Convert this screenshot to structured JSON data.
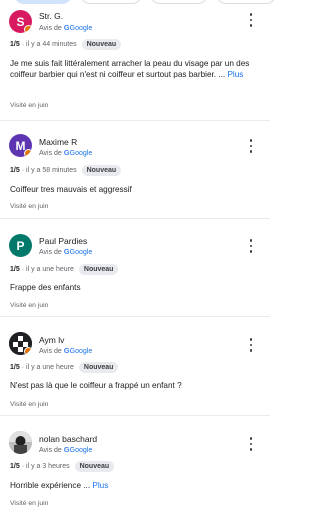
{
  "reviews": [
    {
      "name": "Str. G.",
      "avatar_letter": "S",
      "avatar_color": "#d81b60",
      "source_prefix": "Avis de",
      "source_name": "Google",
      "rating": "1/5",
      "time": "· il y a 44 minutes",
      "badge": "Nouveau",
      "text": "Je me suis fait littéralement arracher la peau du visage par un des coiffeur barbier qui n'est ni coiffeur et surtout pas barbier. ...",
      "more": "Plus",
      "visited": "Visité en juin"
    },
    {
      "name": "Maxime R",
      "avatar_letter": "M",
      "avatar_color": "#5e35b1",
      "source_prefix": "Avis de",
      "source_name": "Google",
      "rating": "1/5",
      "time": "· il y a 58 minutes",
      "badge": "Nouveau",
      "text": "Coiffeur tres mauvais et aggressif",
      "visited": "Visité en juin"
    },
    {
      "name": "Paul Pardies",
      "avatar_letter": "P",
      "avatar_color": "#00796b",
      "source_prefix": "Avis de",
      "source_name": "Google",
      "rating": "1/5",
      "time": "· il y a une heure",
      "badge": "Nouveau",
      "text": "Frappe des enfants",
      "visited": "Visité en juin"
    },
    {
      "name": "Aym lv",
      "avatar_letter": "",
      "avatar_color": "#202124",
      "source_prefix": "Avis de",
      "source_name": "Google",
      "rating": "1/5",
      "time": "· il y a une heure",
      "badge": "Nouveau",
      "text": "N'est pas là que le coiffeur a frappé un enfant ?",
      "visited": "Visité en juin"
    },
    {
      "name": "nolan baschard",
      "avatar_letter": "",
      "avatar_color": "#6d6d6d",
      "source_prefix": "Avis de",
      "source_name": "Google",
      "rating": "1/5",
      "time": "· il y a 3 heures",
      "badge": "Nouveau",
      "text": "Horrible expérience ...",
      "more": "Plus",
      "visited": "Visité en juin"
    }
  ]
}
